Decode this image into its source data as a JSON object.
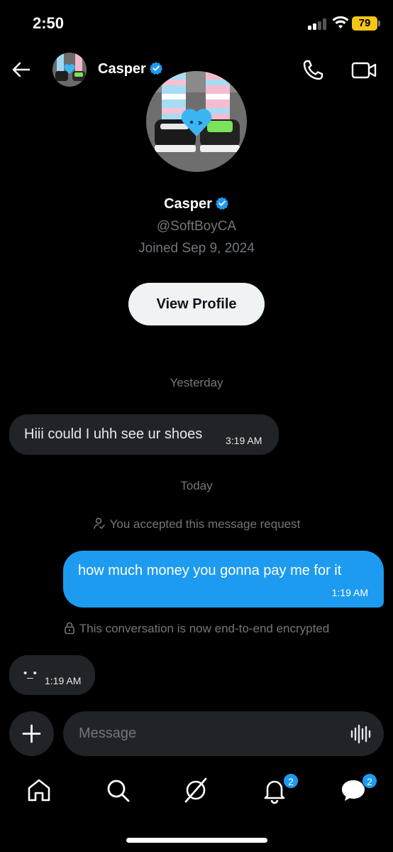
{
  "status_bar": {
    "time": "2:50",
    "battery": "79"
  },
  "header": {
    "name": "Casper"
  },
  "profile": {
    "name": "Casper",
    "handle": "@SoftBoyCA",
    "joined": "Joined Sep 9, 2024",
    "view_profile_label": "View Profile"
  },
  "conversation": {
    "day_yesterday": "Yesterday",
    "msg1": {
      "text": "Hiii could I uhh see ur shoes",
      "time": "3:19 AM"
    },
    "day_today": "Today",
    "accepted_note": "You accepted this message request",
    "msg2": {
      "text": "how much money you gonna pay me for it",
      "time": "1:19 AM"
    },
    "encrypted_note": "This conversation is now end-to-end encrypted",
    "msg3": {
      "text": "•_•",
      "time": "1:19 AM"
    }
  },
  "composer": {
    "placeholder": "Message"
  },
  "nav": {
    "notifications_badge": "2",
    "messages_badge": "2"
  },
  "colors": {
    "accent": "#1d9bf0",
    "background": "#000000",
    "bubble_in": "#202327",
    "muted": "#71767b"
  }
}
